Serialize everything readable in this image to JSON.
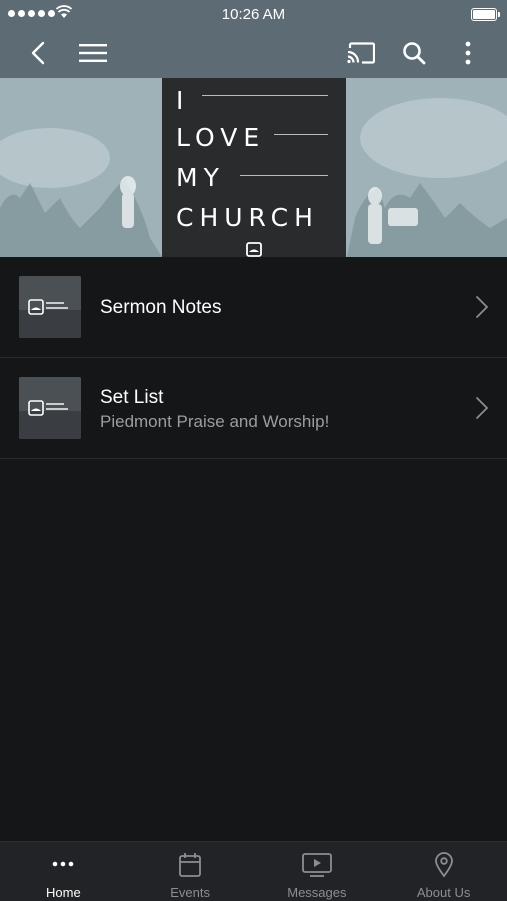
{
  "status_bar": {
    "time": "10:26 AM"
  },
  "navbar": {
    "back_icon": "back-chevron-icon",
    "menu_icon": "hamburger-menu-icon",
    "cast_icon": "cast-icon",
    "search_icon": "search-icon",
    "more_icon": "more-vertical-icon"
  },
  "hero": {
    "words": [
      "I",
      "LOVE",
      "MY",
      "CHURCH"
    ]
  },
  "list": [
    {
      "title": "Sermon Notes",
      "subtitle": ""
    },
    {
      "title": "Set List",
      "subtitle": "Piedmont Praise and Worship!"
    }
  ],
  "tabs": [
    {
      "label": "Home",
      "icon": "more-horizontal-icon",
      "active": true
    },
    {
      "label": "Events",
      "icon": "calendar-icon",
      "active": false
    },
    {
      "label": "Messages",
      "icon": "video-icon",
      "active": false
    },
    {
      "label": "About Us",
      "icon": "map-pin-icon",
      "active": false
    }
  ],
  "colors": {
    "header": "#5c6b74",
    "background": "#151618",
    "tabbar": "#222326",
    "accent_text": "#ffffff"
  }
}
